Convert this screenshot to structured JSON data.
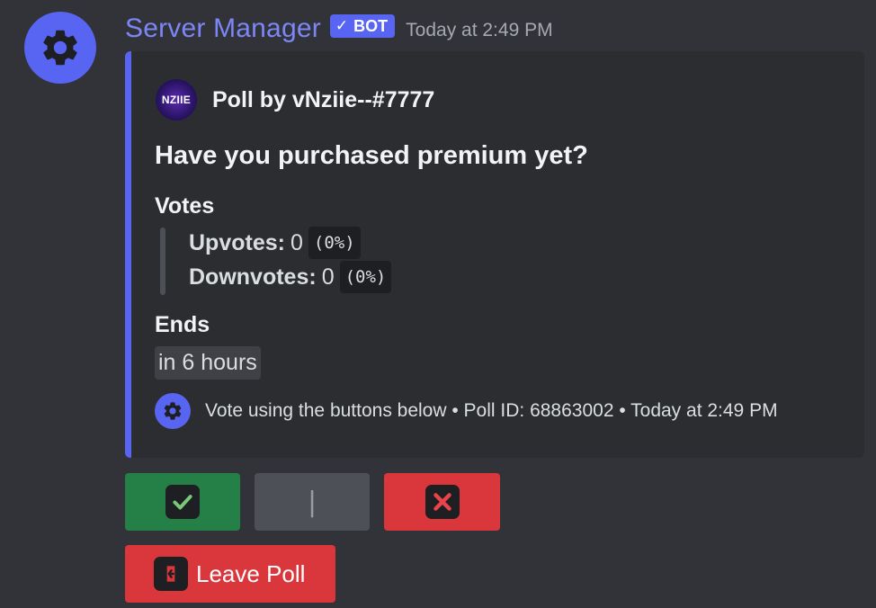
{
  "message": {
    "username": "Server Manager",
    "bot_tag": "BOT",
    "bot_tag_check": "✓",
    "timestamp": "Today at 2:49 PM",
    "avatar_icon": "gear-icon"
  },
  "embed": {
    "accent_color": "#5865f2",
    "author_name": "Poll by vNziie--#7777",
    "author_icon_text": "NZIIE",
    "title": "Have you purchased premium yet?",
    "votes_field": {
      "name": "Votes",
      "upvotes_label": "Upvotes:",
      "upvotes_count": "0",
      "upvotes_percent": "(0%)",
      "downvotes_label": "Downvotes:",
      "downvotes_count": "0",
      "downvotes_percent": "(0%)"
    },
    "ends_field": {
      "name": "Ends",
      "value": "in 6 hours"
    },
    "footer": {
      "icon": "gear-icon",
      "text": "Vote using the buttons below • Poll ID: 68863002 • Today at 2:49 PM"
    }
  },
  "buttons": {
    "upvote": {
      "icon": "check-mark-icon",
      "color": "#248046"
    },
    "neutral": {
      "glyph": "|",
      "color": "#4e5058"
    },
    "downvote": {
      "icon": "cross-mark-icon",
      "color": "#da373c"
    },
    "leave": {
      "label": "Leave Poll",
      "icon": "exit-door-icon",
      "color": "#da373c"
    }
  }
}
